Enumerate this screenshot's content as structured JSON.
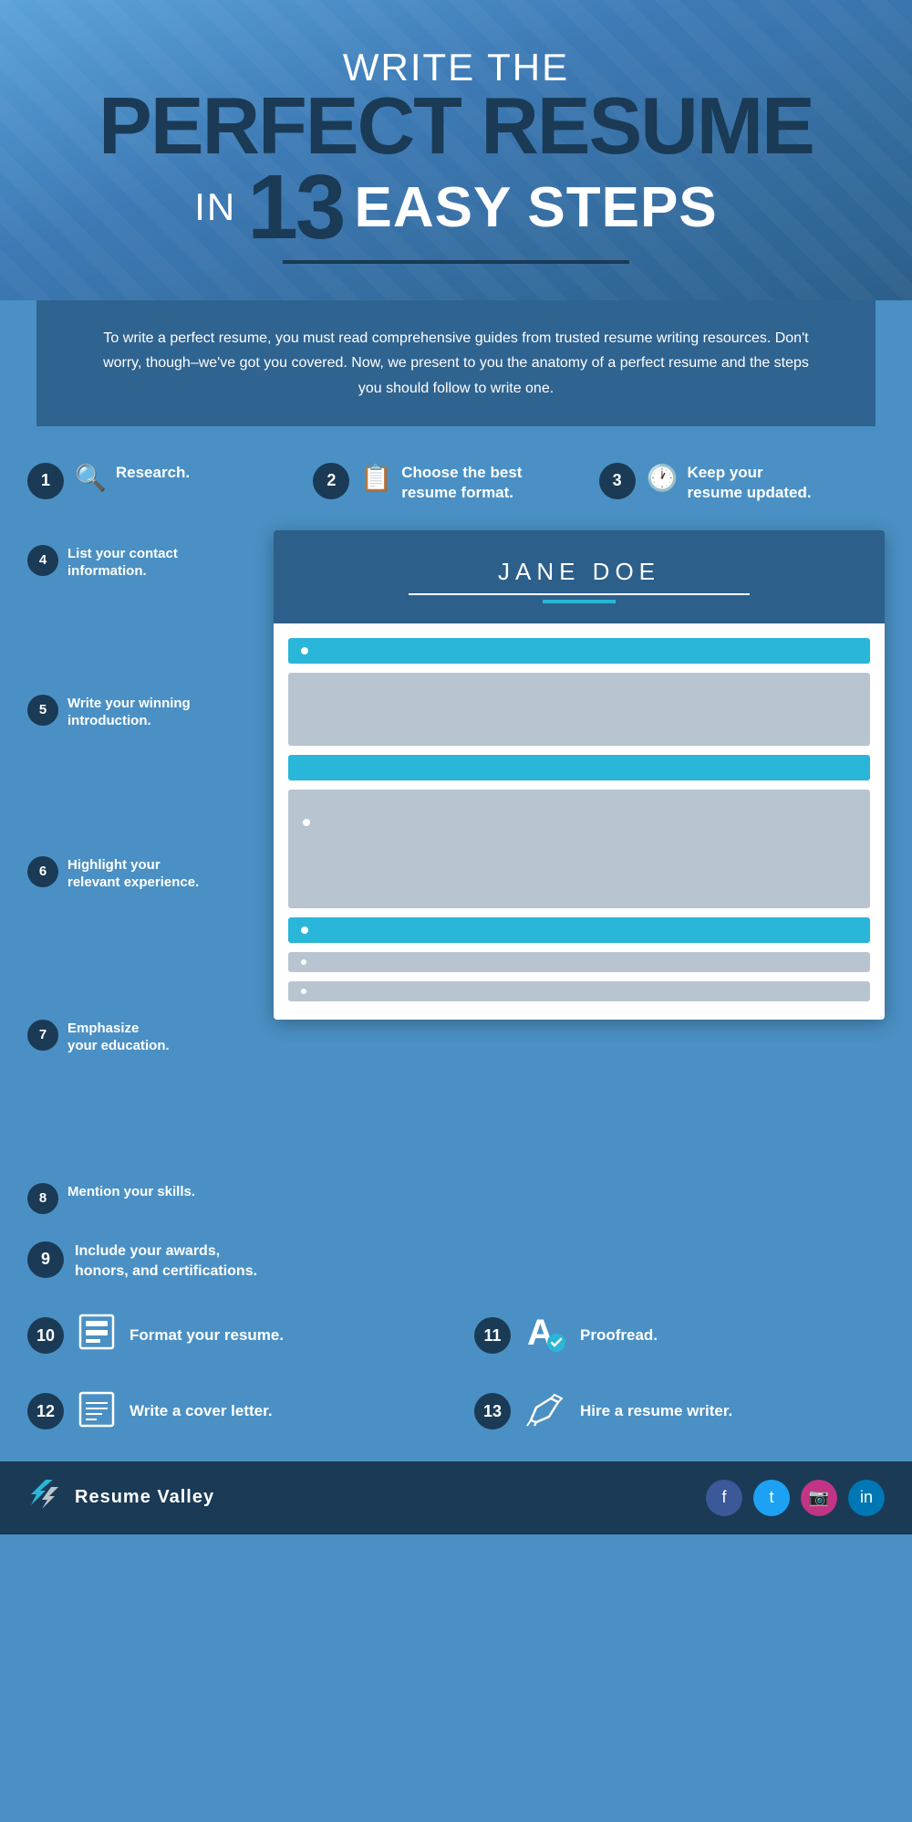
{
  "header": {
    "line1": "Write the",
    "line2": "Perfect Resume",
    "line3_in": "in",
    "line3_num": "13",
    "line3_easy": "Easy Steps"
  },
  "intro": {
    "text": "To write a perfect resume, you must read comprehensive guides from trusted resume writing resources. Don't worry, though–we've got you covered. Now, we present to you the anatomy of a perfect resume and the steps you should follow to write one."
  },
  "steps": {
    "top": [
      {
        "num": "1",
        "icon": "🔍",
        "label": "Research."
      },
      {
        "num": "2",
        "icon": "📋",
        "label": "Choose the best resume format."
      },
      {
        "num": "3",
        "icon": "🕐",
        "label": "Keep your resume updated."
      }
    ],
    "left": [
      {
        "num": "4",
        "label": "List your contact information."
      },
      {
        "num": "5",
        "label": "Write your winning introduction."
      },
      {
        "num": "6",
        "label": "Highlight your relevant experience."
      },
      {
        "num": "7",
        "label": "Emphasize your education."
      },
      {
        "num": "8",
        "label": "Mention your skills."
      }
    ],
    "step9": {
      "num": "9",
      "label": "Include your awards, honors, and certifications."
    },
    "bottom": [
      {
        "num": "10",
        "icon": "format",
        "label": "Format your resume."
      },
      {
        "num": "11",
        "icon": "proofread",
        "label": "Proofread."
      },
      {
        "num": "12",
        "icon": "cover",
        "label": "Write a cover letter."
      },
      {
        "num": "13",
        "icon": "hire",
        "label": "Hire a resume writer."
      }
    ]
  },
  "resume": {
    "name": "JANE DOE"
  },
  "footer": {
    "brand": "Resume Valley",
    "socials": [
      "f",
      "t",
      "📷",
      "in"
    ]
  }
}
